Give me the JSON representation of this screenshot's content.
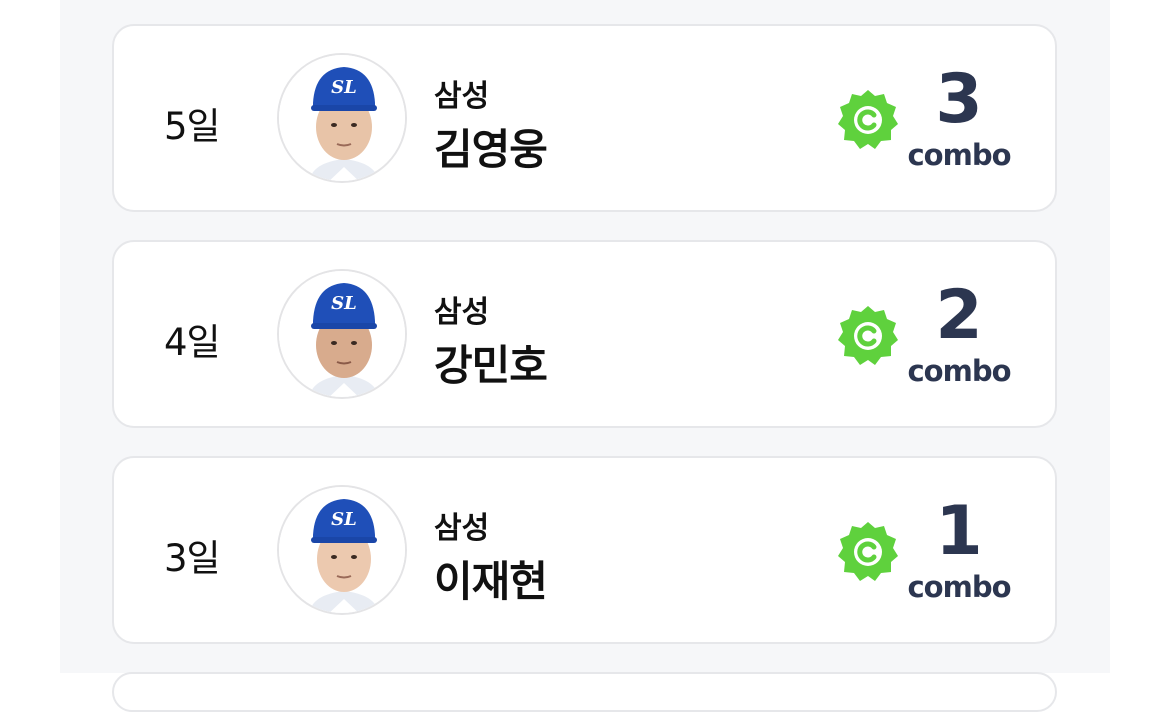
{
  "rows": [
    {
      "day": "5일",
      "team": "삼성",
      "name": "김영웅",
      "combo": "3",
      "combo_label": "combo"
    },
    {
      "day": "4일",
      "team": "삼성",
      "name": "강민호",
      "combo": "2",
      "combo_label": "combo"
    },
    {
      "day": "3일",
      "team": "삼성",
      "name": "이재현",
      "combo": "1",
      "combo_label": "combo"
    }
  ],
  "colors": {
    "badge_green": "#5fd13d",
    "combo_text": "#2c3650",
    "cap_blue": "#1f4fb8"
  },
  "icons": {
    "badge": "c-badge-icon",
    "avatar": "player-photo"
  }
}
